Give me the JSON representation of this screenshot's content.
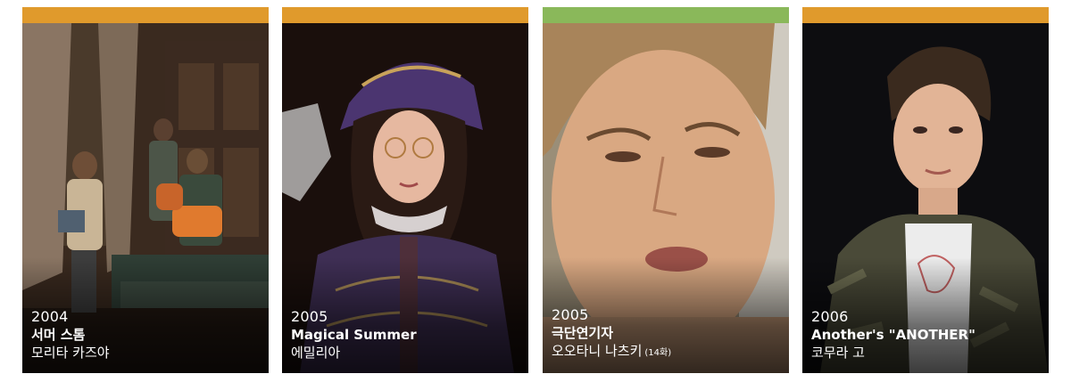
{
  "cards": [
    {
      "year": "2004",
      "title": "서머 스톰",
      "role": "모리타 카즈야",
      "role_note": "",
      "bar_color": "#e09a2c"
    },
    {
      "year": "2005",
      "title": "Magical Summer",
      "role": "에밀리아",
      "role_note": "",
      "bar_color": "#e09a2c"
    },
    {
      "year": "2005",
      "title": "극단연기자",
      "role": "오오타니 나츠키",
      "role_note": "(14화)",
      "bar_color": "#8ab85a"
    },
    {
      "year": "2006",
      "title": "Another's \"ANOTHER\"",
      "role": "코무라 고",
      "role_note": "",
      "bar_color": "#e09a2c"
    }
  ],
  "colors": {
    "caption_text": "#ffffff",
    "page_background": "#ffffff"
  }
}
